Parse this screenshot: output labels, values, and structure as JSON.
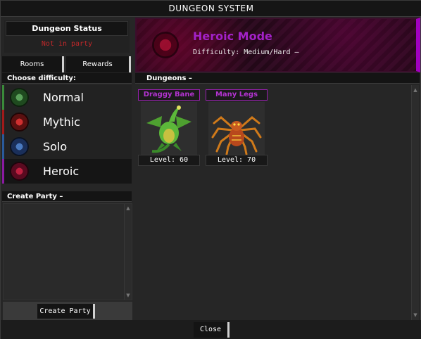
{
  "window": {
    "title": "DUNGEON SYSTEM"
  },
  "status": {
    "heading": "Dungeon Status",
    "value": "Not in party"
  },
  "tabs": [
    {
      "label": "Rooms"
    },
    {
      "label": "Rewards"
    }
  ],
  "difficulty": {
    "heading": "Choose difficulty:",
    "items": [
      {
        "label": "Normal",
        "color": "#3a8a3a"
      },
      {
        "label": "Mythic",
        "color": "#a01a1a"
      },
      {
        "label": "Solo",
        "color": "#2a5a9a"
      },
      {
        "label": "Heroic",
        "color": "#8a1aa0"
      }
    ],
    "selected": "Heroic"
  },
  "party": {
    "heading": "Create Party –",
    "button": "Create Party"
  },
  "banner": {
    "title": "Heroic Mode",
    "subtitle": "Difficulty: Medium/Hard –",
    "accent": "#a321c8"
  },
  "dungeons": {
    "heading": "Dungeons –",
    "items": [
      {
        "name": "Draggy Bane",
        "level": "Level: 60",
        "icon": "dragon-icon"
      },
      {
        "name": "Many Legs",
        "level": "Level: 70",
        "icon": "spider-icon"
      }
    ]
  },
  "footer": {
    "close": "Close"
  }
}
